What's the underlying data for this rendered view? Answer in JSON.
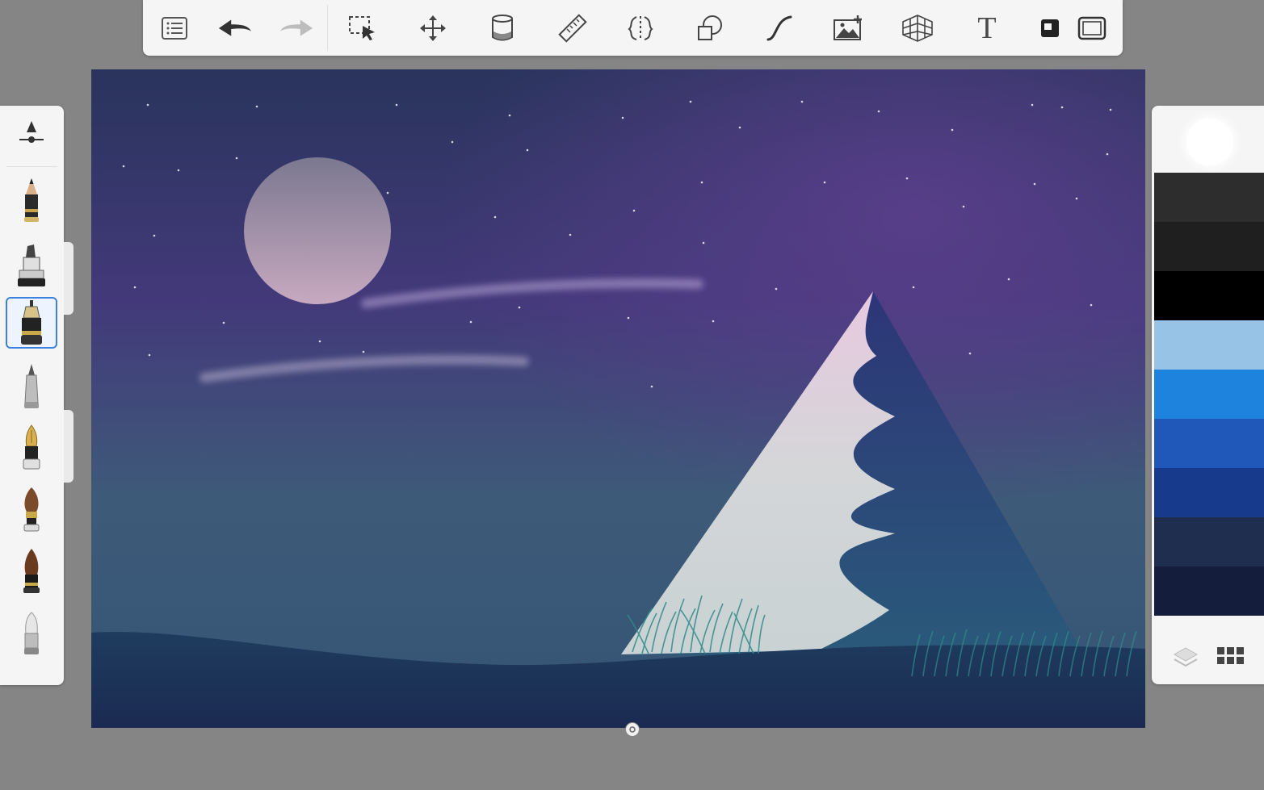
{
  "toolbar": {
    "tools": [
      {
        "name": "list-icon"
      },
      {
        "name": "undo-icon"
      },
      {
        "name": "redo-icon"
      },
      {
        "name": "selection-icon"
      },
      {
        "name": "transform-icon"
      },
      {
        "name": "fill-bucket-icon"
      },
      {
        "name": "ruler-icon"
      },
      {
        "name": "symmetry-icon"
      },
      {
        "name": "shapes-icon"
      },
      {
        "name": "curve-icon"
      },
      {
        "name": "import-image-icon"
      },
      {
        "name": "perspective-grid-icon"
      },
      {
        "name": "text-tool-icon"
      },
      {
        "name": "layer-mask-icon"
      },
      {
        "name": "fullscreen-icon"
      }
    ],
    "text_tool_label": "T"
  },
  "brushes": {
    "selected_index": 2,
    "items": [
      {
        "name": "pencil-brush"
      },
      {
        "name": "marker-brush"
      },
      {
        "name": "technical-pen-brush"
      },
      {
        "name": "ballpoint-brush"
      },
      {
        "name": "fountain-pen-brush"
      },
      {
        "name": "paint-brush"
      },
      {
        "name": "ink-brush"
      },
      {
        "name": "eraser-brush"
      }
    ]
  },
  "colors": {
    "current": "#ffffff",
    "swatches": [
      "#2d2d2d",
      "#1f1f1f",
      "#000000",
      "#96c3e6",
      "#1d83dd",
      "#1f58b8",
      "#173a8c",
      "#1f2d4e",
      "#141d3c"
    ],
    "accent_selected": "#3b82e0",
    "ui_background": "#858585",
    "panel_background": "#f5f5f5"
  },
  "canvas": {
    "sky_top": "#2a3560",
    "sky_purple": "#4f3f80",
    "sky_bottom": "#3e6178",
    "moon": "#a690a8",
    "mountain_light": "#d8dbdc",
    "mountain_dark": "#233f6b",
    "ground": "#1f3a5c",
    "grass": "#2c7c7f"
  }
}
